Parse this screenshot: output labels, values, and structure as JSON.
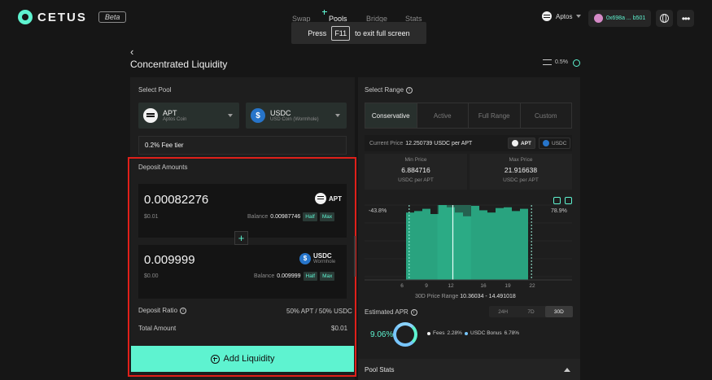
{
  "header": {
    "logo_text": "CETUS",
    "beta_label": "Beta",
    "nav": [
      {
        "label": "Swap"
      },
      {
        "label": "Pools"
      },
      {
        "label": "Bridge"
      },
      {
        "label": "Stats"
      }
    ],
    "fullscreen_banner": {
      "press": "Press",
      "key": "F11",
      "suffix": "to exit full screen"
    },
    "chain": "Aptos",
    "wallet": "0x698a ... b501",
    "more": "•••"
  },
  "page": {
    "back": "‹",
    "title": "Concentrated Liquidity",
    "slippage": "0.5%"
  },
  "left": {
    "select_pool_label": "Select Pool",
    "token_a": {
      "symbol": "APT",
      "name": "Aptos Coin"
    },
    "token_b": {
      "symbol": "USDC",
      "name": "USD Coin (Wormhole)"
    },
    "fee_tier": "0.2% Fee tier",
    "deposit_label": "Deposit Amounts",
    "deposit_a": {
      "amount": "0.00082276",
      "usd": "$0.01",
      "balance_label": "Balance",
      "balance": "0.00987746",
      "token": "APT",
      "half": "Half",
      "max": "Max"
    },
    "deposit_b": {
      "amount": "0.009999",
      "usd": "$0.00",
      "balance_label": "Balance",
      "balance": "0.009999",
      "token": "USDC",
      "token_sub": "Wormhole",
      "half": "Half",
      "max": "Max"
    },
    "plus": "+",
    "deposit_ratio_label": "Deposit Ratio",
    "deposit_ratio": "50% APT / 50% USDC",
    "total_amount_label": "Total Amount",
    "total_amount": "$0.01",
    "add_liquidity": "Add Liquidity"
  },
  "right": {
    "select_range_label": "Select Range",
    "tabs": [
      {
        "label": "Conservative"
      },
      {
        "label": "Active"
      },
      {
        "label": "Full Range"
      },
      {
        "label": "Custom"
      }
    ],
    "current_price_label": "Current Price",
    "current_price": "12.250739 USDC per APT",
    "pill_apt": "APT",
    "pill_usdc": "USDC",
    "min_price": {
      "label": "Min Price",
      "value": "6.884716",
      "unit": "USDC per APT"
    },
    "max_price": {
      "label": "Max Price",
      "value": "21.916638",
      "unit": "USDC per APT"
    },
    "left_pct": "-43.8%",
    "right_pct": "78.9%",
    "range_label": "30D Price Range",
    "range_value": "10.36034 - 14.491018",
    "estimated_apr_label": "Estimated APR",
    "apr_tabs": [
      {
        "label": "24H"
      },
      {
        "label": "7D"
      },
      {
        "label": "30D"
      }
    ],
    "apr_value": "9.06%",
    "fees_label": "Fees",
    "fees_value": "2.28%",
    "bonus_label": "USDC Bonus",
    "bonus_value": "6.78%",
    "pool_stats": "Pool Stats",
    "colors": {
      "accent": "#5ef3d0",
      "fees_dot": "#f0f0f0",
      "bonus_dot": "#78c6ff"
    }
  },
  "chart_data": {
    "type": "area",
    "xlabel": "",
    "ylabel": "",
    "x_ticks": [
      6,
      9,
      12,
      16,
      19,
      22
    ],
    "x": [
      7,
      8,
      9,
      10,
      11,
      12,
      13,
      14,
      15,
      16,
      17,
      18,
      19,
      20,
      21
    ],
    "values": [
      0.9,
      0.92,
      0.95,
      0.88,
      1.0,
      0.97,
      0.9,
      0.85,
      0.99,
      0.93,
      0.9,
      0.96,
      0.97,
      0.92,
      0.95
    ],
    "current_price": 12.250739,
    "range_min": 6.884716,
    "range_max": 21.916638,
    "band_min": 10.36034,
    "band_max": 14.491018,
    "xlim": [
      5,
      23
    ],
    "ylim": [
      0,
      1
    ]
  }
}
